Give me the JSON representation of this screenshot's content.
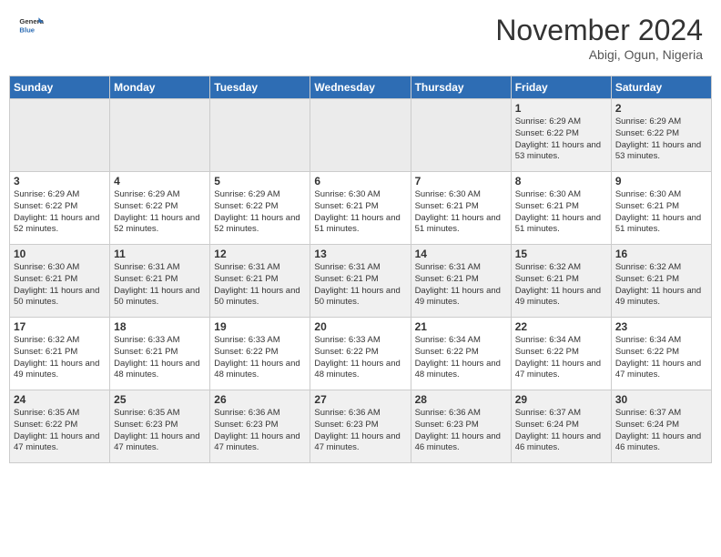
{
  "header": {
    "logo_general": "General",
    "logo_blue": "Blue",
    "month_title": "November 2024",
    "location": "Abigi, Ogun, Nigeria"
  },
  "weekdays": [
    "Sunday",
    "Monday",
    "Tuesday",
    "Wednesday",
    "Thursday",
    "Friday",
    "Saturday"
  ],
  "weeks": [
    [
      {
        "day": "",
        "sunrise": "",
        "sunset": "",
        "daylight": "",
        "empty": true
      },
      {
        "day": "",
        "sunrise": "",
        "sunset": "",
        "daylight": "",
        "empty": true
      },
      {
        "day": "",
        "sunrise": "",
        "sunset": "",
        "daylight": "",
        "empty": true
      },
      {
        "day": "",
        "sunrise": "",
        "sunset": "",
        "daylight": "",
        "empty": true
      },
      {
        "day": "",
        "sunrise": "",
        "sunset": "",
        "daylight": "",
        "empty": true
      },
      {
        "day": "1",
        "sunrise": "Sunrise: 6:29 AM",
        "sunset": "Sunset: 6:22 PM",
        "daylight": "Daylight: 11 hours and 53 minutes.",
        "empty": false
      },
      {
        "day": "2",
        "sunrise": "Sunrise: 6:29 AM",
        "sunset": "Sunset: 6:22 PM",
        "daylight": "Daylight: 11 hours and 53 minutes.",
        "empty": false
      }
    ],
    [
      {
        "day": "3",
        "sunrise": "Sunrise: 6:29 AM",
        "sunset": "Sunset: 6:22 PM",
        "daylight": "Daylight: 11 hours and 52 minutes.",
        "empty": false
      },
      {
        "day": "4",
        "sunrise": "Sunrise: 6:29 AM",
        "sunset": "Sunset: 6:22 PM",
        "daylight": "Daylight: 11 hours and 52 minutes.",
        "empty": false
      },
      {
        "day": "5",
        "sunrise": "Sunrise: 6:29 AM",
        "sunset": "Sunset: 6:22 PM",
        "daylight": "Daylight: 11 hours and 52 minutes.",
        "empty": false
      },
      {
        "day": "6",
        "sunrise": "Sunrise: 6:30 AM",
        "sunset": "Sunset: 6:21 PM",
        "daylight": "Daylight: 11 hours and 51 minutes.",
        "empty": false
      },
      {
        "day": "7",
        "sunrise": "Sunrise: 6:30 AM",
        "sunset": "Sunset: 6:21 PM",
        "daylight": "Daylight: 11 hours and 51 minutes.",
        "empty": false
      },
      {
        "day": "8",
        "sunrise": "Sunrise: 6:30 AM",
        "sunset": "Sunset: 6:21 PM",
        "daylight": "Daylight: 11 hours and 51 minutes.",
        "empty": false
      },
      {
        "day": "9",
        "sunrise": "Sunrise: 6:30 AM",
        "sunset": "Sunset: 6:21 PM",
        "daylight": "Daylight: 11 hours and 51 minutes.",
        "empty": false
      }
    ],
    [
      {
        "day": "10",
        "sunrise": "Sunrise: 6:30 AM",
        "sunset": "Sunset: 6:21 PM",
        "daylight": "Daylight: 11 hours and 50 minutes.",
        "empty": false
      },
      {
        "day": "11",
        "sunrise": "Sunrise: 6:31 AM",
        "sunset": "Sunset: 6:21 PM",
        "daylight": "Daylight: 11 hours and 50 minutes.",
        "empty": false
      },
      {
        "day": "12",
        "sunrise": "Sunrise: 6:31 AM",
        "sunset": "Sunset: 6:21 PM",
        "daylight": "Daylight: 11 hours and 50 minutes.",
        "empty": false
      },
      {
        "day": "13",
        "sunrise": "Sunrise: 6:31 AM",
        "sunset": "Sunset: 6:21 PM",
        "daylight": "Daylight: 11 hours and 50 minutes.",
        "empty": false
      },
      {
        "day": "14",
        "sunrise": "Sunrise: 6:31 AM",
        "sunset": "Sunset: 6:21 PM",
        "daylight": "Daylight: 11 hours and 49 minutes.",
        "empty": false
      },
      {
        "day": "15",
        "sunrise": "Sunrise: 6:32 AM",
        "sunset": "Sunset: 6:21 PM",
        "daylight": "Daylight: 11 hours and 49 minutes.",
        "empty": false
      },
      {
        "day": "16",
        "sunrise": "Sunrise: 6:32 AM",
        "sunset": "Sunset: 6:21 PM",
        "daylight": "Daylight: 11 hours and 49 minutes.",
        "empty": false
      }
    ],
    [
      {
        "day": "17",
        "sunrise": "Sunrise: 6:32 AM",
        "sunset": "Sunset: 6:21 PM",
        "daylight": "Daylight: 11 hours and 49 minutes.",
        "empty": false
      },
      {
        "day": "18",
        "sunrise": "Sunrise: 6:33 AM",
        "sunset": "Sunset: 6:21 PM",
        "daylight": "Daylight: 11 hours and 48 minutes.",
        "empty": false
      },
      {
        "day": "19",
        "sunrise": "Sunrise: 6:33 AM",
        "sunset": "Sunset: 6:22 PM",
        "daylight": "Daylight: 11 hours and 48 minutes.",
        "empty": false
      },
      {
        "day": "20",
        "sunrise": "Sunrise: 6:33 AM",
        "sunset": "Sunset: 6:22 PM",
        "daylight": "Daylight: 11 hours and 48 minutes.",
        "empty": false
      },
      {
        "day": "21",
        "sunrise": "Sunrise: 6:34 AM",
        "sunset": "Sunset: 6:22 PM",
        "daylight": "Daylight: 11 hours and 48 minutes.",
        "empty": false
      },
      {
        "day": "22",
        "sunrise": "Sunrise: 6:34 AM",
        "sunset": "Sunset: 6:22 PM",
        "daylight": "Daylight: 11 hours and 47 minutes.",
        "empty": false
      },
      {
        "day": "23",
        "sunrise": "Sunrise: 6:34 AM",
        "sunset": "Sunset: 6:22 PM",
        "daylight": "Daylight: 11 hours and 47 minutes.",
        "empty": false
      }
    ],
    [
      {
        "day": "24",
        "sunrise": "Sunrise: 6:35 AM",
        "sunset": "Sunset: 6:22 PM",
        "daylight": "Daylight: 11 hours and 47 minutes.",
        "empty": false
      },
      {
        "day": "25",
        "sunrise": "Sunrise: 6:35 AM",
        "sunset": "Sunset: 6:23 PM",
        "daylight": "Daylight: 11 hours and 47 minutes.",
        "empty": false
      },
      {
        "day": "26",
        "sunrise": "Sunrise: 6:36 AM",
        "sunset": "Sunset: 6:23 PM",
        "daylight": "Daylight: 11 hours and 47 minutes.",
        "empty": false
      },
      {
        "day": "27",
        "sunrise": "Sunrise: 6:36 AM",
        "sunset": "Sunset: 6:23 PM",
        "daylight": "Daylight: 11 hours and 47 minutes.",
        "empty": false
      },
      {
        "day": "28",
        "sunrise": "Sunrise: 6:36 AM",
        "sunset": "Sunset: 6:23 PM",
        "daylight": "Daylight: 11 hours and 46 minutes.",
        "empty": false
      },
      {
        "day": "29",
        "sunrise": "Sunrise: 6:37 AM",
        "sunset": "Sunset: 6:24 PM",
        "daylight": "Daylight: 11 hours and 46 minutes.",
        "empty": false
      },
      {
        "day": "30",
        "sunrise": "Sunrise: 6:37 AM",
        "sunset": "Sunset: 6:24 PM",
        "daylight": "Daylight: 11 hours and 46 minutes.",
        "empty": false
      }
    ]
  ]
}
